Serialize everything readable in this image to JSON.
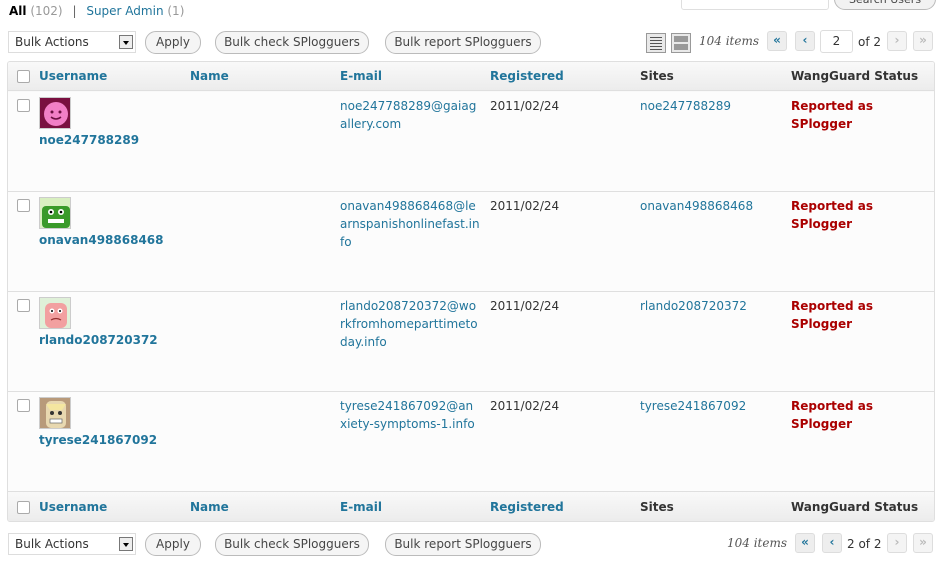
{
  "views": {
    "all_label": "All",
    "all_count": "(102)",
    "separator": "|",
    "super_admin_label": "Super Admin",
    "super_admin_count": "(1)"
  },
  "search": {
    "button_label": "Search Users",
    "value": ""
  },
  "tablenav": {
    "bulk_actions": "Bulk Actions",
    "apply": "Apply",
    "bulk_check": "Bulk check SPlogguers",
    "bulk_report": "Bulk report SPlogguers",
    "items": "104 items",
    "first": "«",
    "prev": "‹",
    "next": "›",
    "last": "»",
    "current_page": "2",
    "of_pages": "of 2",
    "bottom_page_text": "2 of 2"
  },
  "columns": {
    "username": "Username",
    "name": "Name",
    "email": "E-mail",
    "registered": "Registered",
    "sites": "Sites",
    "status": "WangGuard Status"
  },
  "rows": [
    {
      "username": "noe247788289",
      "email": "noe247788289@gaiagallery.com",
      "registered": "2011/02/24",
      "site": "noe247788289",
      "status": "Reported as SPlogger",
      "avatar": "pink-smiley-avatar"
    },
    {
      "username": "onavan498868468",
      "email": "onavan498868468@learnspanishonlinefast.info",
      "registered": "2011/02/24",
      "site": "onavan498868468",
      "status": "Reported as SPlogger",
      "avatar": "green-monster-avatar"
    },
    {
      "username": "rlando208720372",
      "email": "rlando208720372@workfromhomeparttimetoday.info",
      "registered": "2011/02/24",
      "site": "rlando208720372",
      "status": "Reported as SPlogger",
      "avatar": "pink-monster-avatar"
    },
    {
      "username": "tyrese241867092",
      "email": "tyrese241867092@anxiety-symptoms-1.info",
      "registered": "2011/02/24",
      "site": "tyrese241867092",
      "status": "Reported as SPlogger",
      "avatar": "tan-grin-avatar"
    }
  ],
  "colors": {
    "link": "#21759b",
    "status": "#aa0000"
  }
}
